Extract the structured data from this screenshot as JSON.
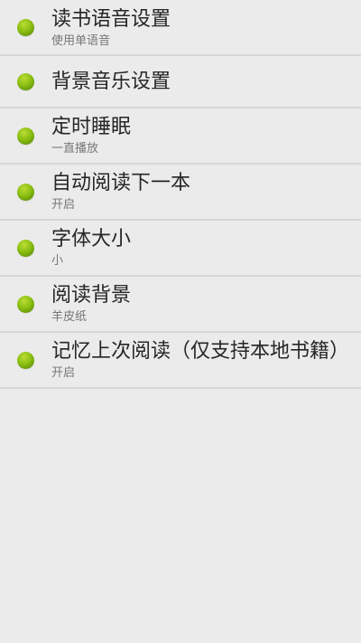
{
  "settings": {
    "items": [
      {
        "title": "读书语音设置",
        "subtitle": "使用单语音"
      },
      {
        "title": "背景音乐设置",
        "subtitle": ""
      },
      {
        "title": "定时睡眠",
        "subtitle": "一直播放"
      },
      {
        "title": "自动阅读下一本",
        "subtitle": "开启"
      },
      {
        "title": "字体大小",
        "subtitle": "小"
      },
      {
        "title": "阅读背景",
        "subtitle": "羊皮纸"
      },
      {
        "title": "记忆上次阅读（仅支持本地书籍）",
        "subtitle": "开启"
      }
    ]
  },
  "colors": {
    "background": "#ebebeb",
    "divider": "#d7d7d7",
    "bullet": "#8cbf13",
    "title_text": "#262626",
    "subtitle_text": "#777777"
  }
}
